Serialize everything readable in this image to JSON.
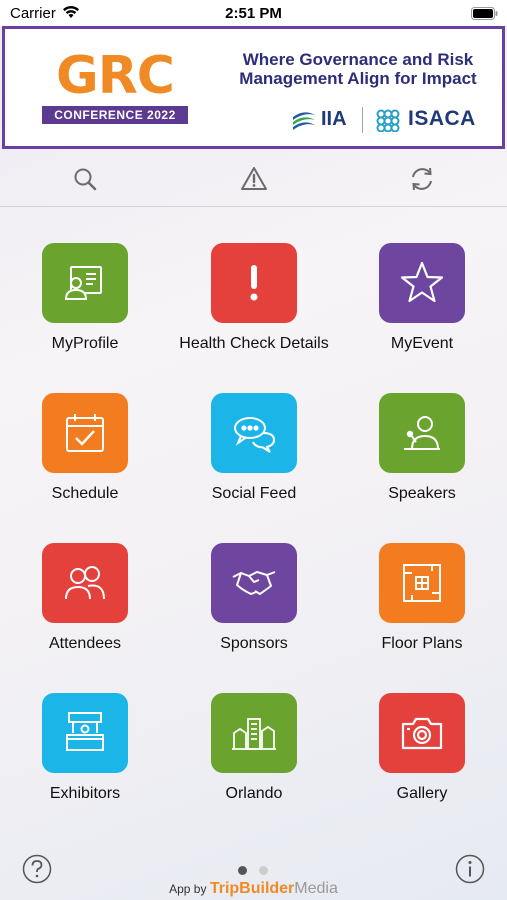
{
  "status_bar": {
    "carrier": "Carrier",
    "time": "2:51 PM"
  },
  "banner": {
    "logo_main": "GRC",
    "logo_sub": "CONFERENCE 2022",
    "tagline": "Where Governance and Risk Management Align for Impact",
    "partner_1": "IIA",
    "partner_2": "ISACA"
  },
  "toolbar": {
    "icons": [
      "search-icon",
      "alert-icon",
      "sync-icon"
    ]
  },
  "tiles": [
    {
      "label": "MyProfile",
      "color": "#6aa32e",
      "icon": "profile-card-icon"
    },
    {
      "label": "Health Check Details",
      "color": "#e5413c",
      "icon": "exclamation-icon"
    },
    {
      "label": "MyEvent",
      "color": "#6e46a0",
      "icon": "star-icon"
    },
    {
      "label": "Schedule",
      "color": "#f47c20",
      "icon": "calendar-check-icon"
    },
    {
      "label": "Social Feed",
      "color": "#1cb5e8",
      "icon": "chat-bubbles-icon"
    },
    {
      "label": "Speakers",
      "color": "#6aa32e",
      "icon": "speaker-podium-icon"
    },
    {
      "label": "Attendees",
      "color": "#e5413c",
      "icon": "people-icon"
    },
    {
      "label": "Sponsors",
      "color": "#6e46a0",
      "icon": "handshake-icon"
    },
    {
      "label": "Floor Plans",
      "color": "#f47c20",
      "icon": "floor-plan-icon"
    },
    {
      "label": "Exhibitors",
      "color": "#1cb5e8",
      "icon": "booth-icon"
    },
    {
      "label": "Orlando",
      "color": "#6aa32e",
      "icon": "city-icon"
    },
    {
      "label": "Gallery",
      "color": "#e5413c",
      "icon": "camera-icon"
    }
  ],
  "footer": {
    "credit_prefix": "App by",
    "credit_brand": "TripBuilder",
    "credit_brand_suffix": "Media",
    "active_page": 1,
    "page_count": 2
  },
  "colors": {
    "banner_border": "#6b3fa0",
    "brand_orange": "#f08a24",
    "brand_navy": "#2d2d7a"
  }
}
